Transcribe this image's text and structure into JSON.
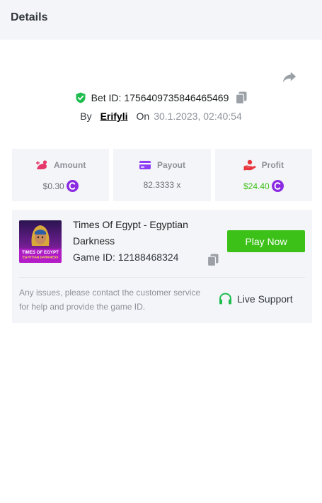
{
  "header": {
    "title": "Details"
  },
  "bet": {
    "id_label": "Bet ID:",
    "id_value": "1756409735846465469",
    "by_label": "By",
    "username": "Erifyli",
    "on_label": "On",
    "date": "30.1.2023, 02:40:54"
  },
  "stats": {
    "amount": {
      "label": "Amount",
      "value": "$0.30"
    },
    "payout": {
      "label": "Payout",
      "value": "82.3333 x"
    },
    "profit": {
      "label": "Profit",
      "value": "$24.40"
    }
  },
  "game": {
    "title": "Times Of Egypt - Egyptian Darkness",
    "thumb_line1": "TIMES OF EGYPT",
    "thumb_line2": "EGYPTIAN DARKNESS",
    "id_label": "Game ID:",
    "id_value": "12188468324",
    "play_label": "Play Now",
    "issue_text": "Any issues, please contact the customer service for help and provide the game ID.",
    "support_label": "Live Support"
  },
  "colors": {
    "green": "#3bc117",
    "coin_purple": "#8a2be2",
    "card_bg": "#f4f5f8",
    "icon_pink": "#e5396b",
    "icon_purple": "#8c3ff3",
    "icon_red": "#e8373d"
  },
  "icons": {
    "share": "share-icon",
    "shield": "shield-check-icon",
    "copy": "copy-icon",
    "amount": "amount-icon",
    "payout": "payout-card-icon",
    "profit": "profit-hand-icon",
    "coin": "coin-icon",
    "support": "headset-icon"
  }
}
